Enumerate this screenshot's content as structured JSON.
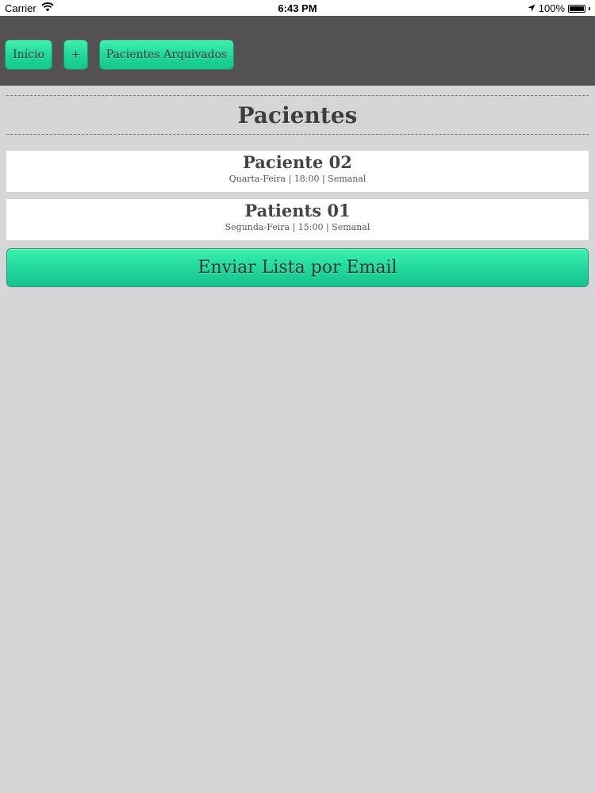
{
  "status_bar": {
    "carrier": "Carrier",
    "time": "6:43 PM",
    "battery_percent": "100%",
    "battery_level": 1.0
  },
  "nav": {
    "home_label": "Início",
    "add_label": "+",
    "archived_label": "Pacientes Arquivados"
  },
  "page": {
    "title": "Pacientes"
  },
  "patients": [
    {
      "name": "Paciente 02",
      "info": "Quarta-Feira | 18:00 | Semanal"
    },
    {
      "name": "Patients 01",
      "info": "Segunda-Feira | 15:00 | Semanal"
    }
  ],
  "actions": {
    "email_label": "Enviar Lista por Email"
  },
  "colors": {
    "accent": "#26df9f",
    "nav_background": "#535154",
    "page_background": "#d5d5d7"
  }
}
